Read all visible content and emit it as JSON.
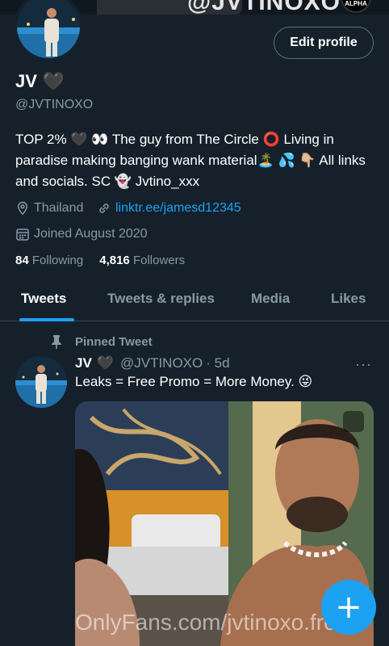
{
  "banner": {
    "text": "@JVTINOXO",
    "badge": "ALPHA"
  },
  "profile": {
    "name": "JV",
    "name_emoji": "🖤",
    "handle": "@JVTINOXO",
    "edit_button": "Edit profile",
    "bio": "TOP 2% 🖤 👀 The guy from The Circle ⭕ Living in paradise making banging wank material🏝️ 💦 👇🏼 All links and socials. SC 👻 Jvtino_xxx",
    "location": "Thailand",
    "link": "linktr.ee/jamesd12345",
    "joined": "Joined August 2020",
    "following_count": "84",
    "following_label": "Following",
    "followers_count": "4,816",
    "followers_label": "Followers"
  },
  "tabs": [
    {
      "label": "Tweets",
      "active": true
    },
    {
      "label": "Tweets & replies",
      "active": false
    },
    {
      "label": "Media",
      "active": false
    },
    {
      "label": "Likes",
      "active": false
    }
  ],
  "tweet": {
    "pinned_label": "Pinned Tweet",
    "name": "JV",
    "name_emoji": "🖤",
    "handle": "@JVTINOXO",
    "time": "· 5d",
    "more": "···",
    "text": "Leaks = Free Promo = More Money. 😜"
  },
  "fab": {
    "label": "+"
  },
  "watermark": "OnlyFans.com/jvtinoxo.free",
  "colors": {
    "background": "#15202b",
    "accent": "#1da1f2",
    "muted": "#8899a6",
    "border": "#38444d"
  }
}
